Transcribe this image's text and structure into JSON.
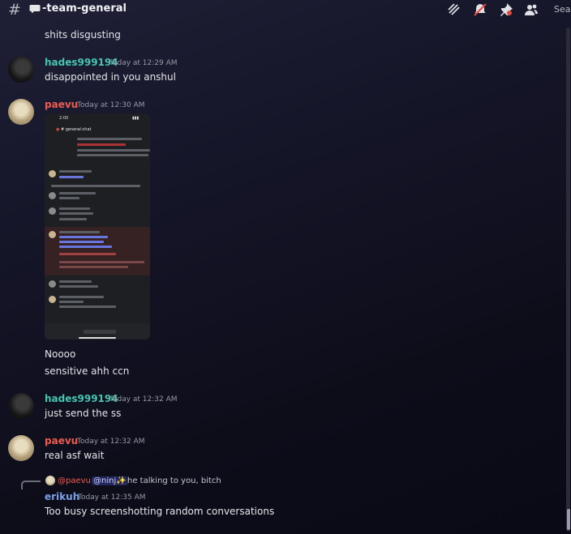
{
  "header": {
    "channel_name": "-team-general",
    "search_label": "Sear"
  },
  "messages": {
    "m0": {
      "text": "shits disgusting"
    },
    "m1": {
      "author": "hades999194",
      "timestamp": "Today at 12:29 AM",
      "text": "disappointed in you anshul"
    },
    "m2": {
      "author": "paevu",
      "timestamp": "Today at 12:30 AM",
      "attachment": {
        "time": "2:00",
        "title": "general-chat"
      },
      "text1": "Noooo",
      "text2": "sensitive ahh ccn"
    },
    "m3": {
      "author": "hades999194",
      "timestamp": "Today at 12:32 AM",
      "text": "just send the ss"
    },
    "m4": {
      "author": "paevu",
      "timestamp": "Today at 12:32 AM",
      "text": "real asf wait"
    },
    "m5": {
      "reply": {
        "author": "@paevu",
        "mention": "@ninj✨",
        "text": "he talking to you, bitch"
      },
      "author": "erikuh",
      "timestamp": "Today at 12:35 AM",
      "text": "Too busy screenshotting random conversations"
    }
  },
  "colors": {
    "teal_username": "#47c5b0",
    "red_username": "#ec5b50",
    "blue_username": "#7aa0e6"
  }
}
